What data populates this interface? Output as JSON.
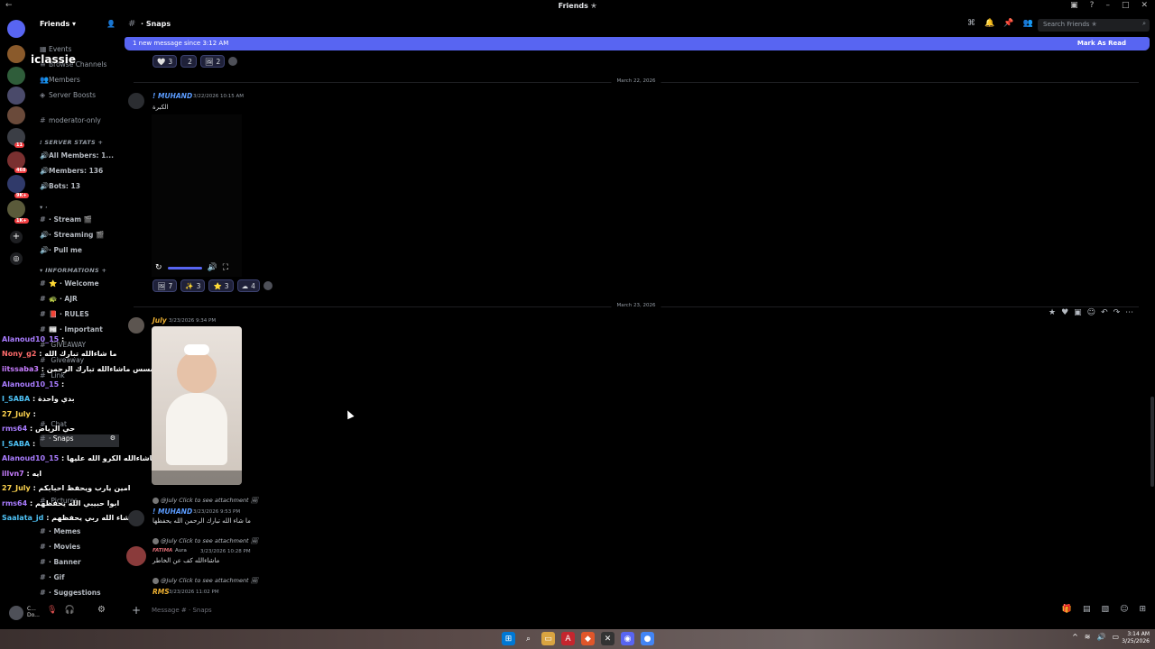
{
  "titlebar": {
    "title": "Friends ✭",
    "left": "←"
  },
  "server": {
    "name": "Friends",
    "badges": [
      "11",
      "468",
      "9K+",
      "1K+"
    ]
  },
  "sidebar": {
    "top_items": [
      "Events",
      "Browse Channels",
      "Members",
      "Server Boosts"
    ],
    "mod_channel": "moderator-only",
    "stats_category": "SERVER STATS",
    "stats": [
      "All Members: 1...",
      "Members: 136",
      "Bots: 13"
    ],
    "streams": [
      "Stream 🎬",
      "Streaming 🎬",
      "Pull me"
    ],
    "info_category": "INFORMATIONS",
    "info": [
      "Welcome",
      "AJR",
      "RULES",
      "Important",
      "GIVEAWAY",
      "Giveaway",
      "Link"
    ],
    "public": [
      "Chat",
      "Snaps"
    ],
    "lower": [
      "Pictures",
      "Memes",
      "Movies",
      "Banner",
      "Gif",
      "Suggestions"
    ]
  },
  "overlay": {
    "streamer": "iclassie",
    "lines": [
      {
        "user": "Alanoud10_15",
        "msg": ":"
      },
      {
        "user": "Nony_g2",
        "msg": ": ما شاءالله تبارك الله"
      },
      {
        "user": "iitssaba3",
        "msg": ": ووسسس ماشاءالله تبارك الرحمن"
      },
      {
        "user": "Alanoud10_15",
        "msg": ":"
      },
      {
        "user": "I_SABA",
        "msg": ": بدي واحدة"
      },
      {
        "user": "27_July",
        "msg": ":"
      },
      {
        "user": "rms64",
        "msg": ": حي الرياض"
      },
      {
        "user": "I_SABA",
        "msg": ":"
      },
      {
        "user": "Alanoud10_15",
        "msg": ": ماشاءالله الكرو الله عليها"
      },
      {
        "user": "illvn7",
        "msg": ": ايه"
      },
      {
        "user": "27_July",
        "msg": ": امين يارب ويحفظ احبابكم"
      },
      {
        "user": "rms64",
        "msg": ": ابوا حبيبي الله يحفظهم"
      },
      {
        "user": "Saalata_jd",
        "msg": ": ما شاء الله ربي يحفظهم"
      }
    ]
  },
  "header": {
    "channel": "Snaps",
    "search_placeholder": "Search Friends ✭"
  },
  "newbar": {
    "text": "1 new message since 3:12 AM",
    "action": "Mark As Read"
  },
  "top_reactions": [
    {
      "emoji": "🤍",
      "count": "3"
    },
    {
      "emoji": "",
      "count": "2"
    },
    {
      "emoji": "🖼",
      "count": "2"
    }
  ],
  "dates": [
    "March 22, 2026",
    "March 23, 2026"
  ],
  "messages": [
    {
      "user": "! MUHAND",
      "time": "3/22/2026 10:15 AM",
      "text": "الكبرة",
      "color": "#5b9cff"
    },
    {
      "user": "July",
      "time": "3/23/2026 9:34 PM",
      "color": "#f0b232"
    },
    {
      "user": "! MUHAND",
      "time": "3/23/2026 9:53 PM",
      "text": "ما شاء الله تبارك الرحمن الله يحفظها",
      "color": "#5b9cff"
    },
    {
      "user": "FATIMA",
      "tag": "Aura",
      "time": "3/23/2026 10:28 PM",
      "text": "ماشاءالله كف عن الخاطر",
      "color": "#e06c75"
    },
    {
      "user": "RMS",
      "time": "3/23/2026 11:02 PM",
      "color": "#f0b232"
    }
  ],
  "replies": [
    "@July Click to see attachment",
    "@July Click to see attachment",
    "@July Click to see attachment"
  ],
  "mid_reactions": [
    {
      "emoji": "🖼",
      "count": "7"
    },
    {
      "emoji": "✨",
      "count": "3"
    },
    {
      "emoji": "⭐",
      "count": "3"
    },
    {
      "emoji": "☁",
      "count": "4"
    }
  ],
  "composer": {
    "placeholder": "Message # · Snaps"
  },
  "user": {
    "name": "C...",
    "status": "Do..."
  },
  "clock": {
    "time": "3:14 AM",
    "date": "3/25/2026"
  }
}
